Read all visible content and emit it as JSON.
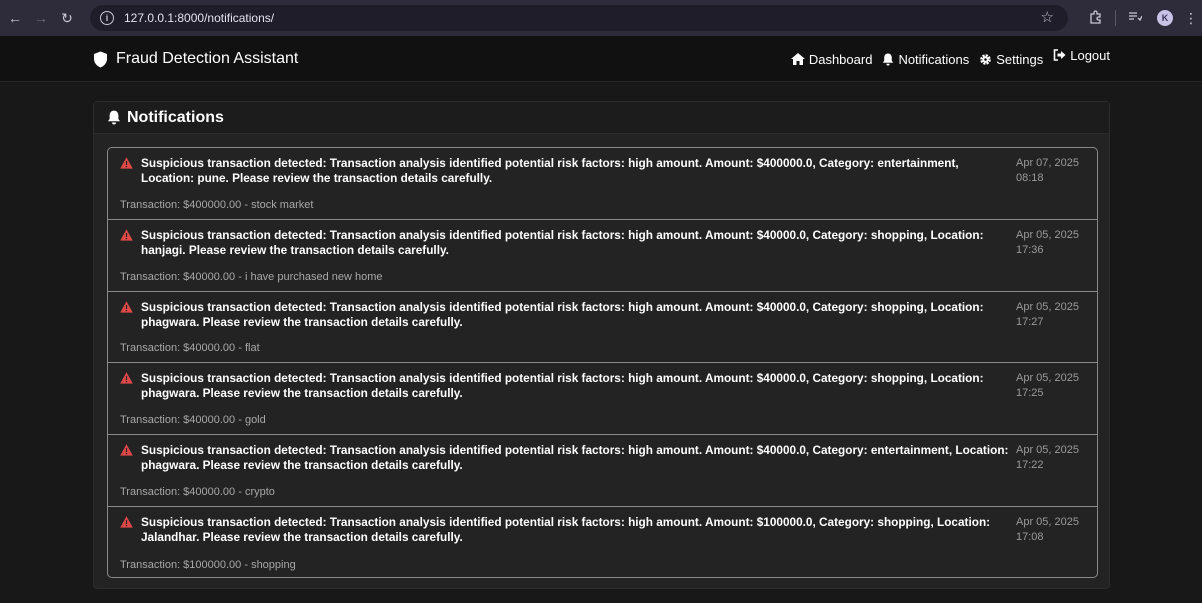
{
  "browser": {
    "url": "127.0.0.1:8000/notifications/",
    "avatar_letter": "K"
  },
  "brand": {
    "name": "Fraud Detection Assistant"
  },
  "nav": [
    {
      "label": "Dashboard",
      "icon": "home-icon"
    },
    {
      "label": "Notifications",
      "icon": "bell-icon"
    },
    {
      "label": "Settings",
      "icon": "gear-icon"
    },
    {
      "label": "Logout",
      "icon": "logout-icon"
    }
  ],
  "card": {
    "title": "Notifications"
  },
  "notifications": [
    {
      "message": "Suspicious transaction detected: Transaction analysis identified potential risk factors: high amount. Amount: $400000.0, Category: entertainment, Location: pune. Please review the transaction details carefully.",
      "date": "Apr 07, 2025",
      "time": "08:18",
      "transaction": "Transaction: $400000.00 - stock market"
    },
    {
      "message": "Suspicious transaction detected: Transaction analysis identified potential risk factors: high amount. Amount: $40000.0, Category: shopping, Location: hanjagi. Please review the transaction details carefully.",
      "date": "Apr 05, 2025",
      "time": "17:36",
      "transaction": "Transaction: $40000.00 - i have purchased new home"
    },
    {
      "message": "Suspicious transaction detected: Transaction analysis identified potential risk factors: high amount. Amount: $40000.0, Category: shopping, Location: phagwara. Please review the transaction details carefully.",
      "date": "Apr 05, 2025",
      "time": "17:27",
      "transaction": "Transaction: $40000.00 - flat"
    },
    {
      "message": "Suspicious transaction detected: Transaction analysis identified potential risk factors: high amount. Amount: $40000.0, Category: shopping, Location: phagwara. Please review the transaction details carefully.",
      "date": "Apr 05, 2025",
      "time": "17:25",
      "transaction": "Transaction: $40000.00 - gold"
    },
    {
      "message": "Suspicious transaction detected: Transaction analysis identified potential risk factors: high amount. Amount: $40000.0, Category: entertainment, Location: phagwara. Please review the transaction details carefully.",
      "date": "Apr 05, 2025",
      "time": "17:22",
      "transaction": "Transaction: $40000.00 - crypto"
    },
    {
      "message": "Suspicious transaction detected: Transaction analysis identified potential risk factors: high amount. Amount: $100000.0, Category: shopping, Location: Jalandhar. Please review the transaction details carefully.",
      "date": "Apr 05, 2025",
      "time": "17:08",
      "transaction": "Transaction: $100000.00 - shopping"
    }
  ],
  "colors": {
    "alert": "#e04848",
    "background": "#181818",
    "card": "#232323"
  }
}
